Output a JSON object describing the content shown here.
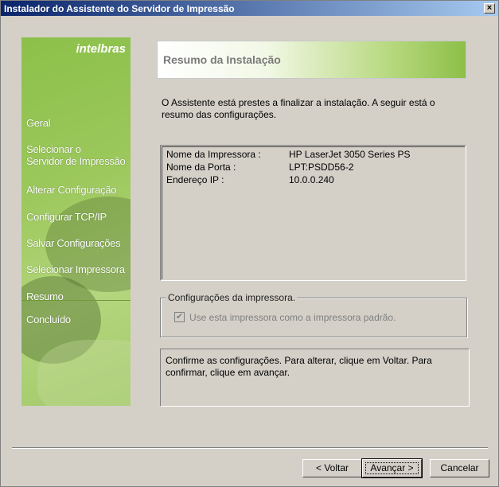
{
  "window": {
    "title": "Instalador do Assistente do Servidor de Impressão",
    "close_label": "×"
  },
  "sidebar": {
    "logo": "intelbras",
    "steps": [
      {
        "label": "Geral"
      },
      {
        "label": "Selecionar o\nServidor de Impressão"
      },
      {
        "label": "Alterar Configuração"
      },
      {
        "label": "Configurar TCP/IP"
      },
      {
        "label": "Salvar Configurações"
      },
      {
        "label": "Selecionar Impressora"
      },
      {
        "label": "Resumo"
      },
      {
        "label": "Concluído"
      }
    ],
    "current_step": "Resumo"
  },
  "header": {
    "title": "Resumo da Instalação"
  },
  "intro": "O Assistente está prestes a finalizar a instalação. A seguir está o resumo das configurações.",
  "summary": {
    "rows": [
      {
        "key": "Nome da Impressora :",
        "value": "HP LaserJet 3050 Series PS"
      },
      {
        "key": "Nome da Porta :",
        "value": "LPT:PSDD56-2"
      },
      {
        "key": "Endereço IP :",
        "value": "10.0.0.240"
      }
    ]
  },
  "printer_settings": {
    "legend": "Configurações da impressora.",
    "default_printer_label": "Use esta impressora como a impressora padrão.",
    "default_printer_checked": true,
    "default_printer_enabled": false
  },
  "note": "Confirme as configurações. Para alterar, clique em Voltar. Para confirmar, clique em avançar.",
  "buttons": {
    "back": "< Voltar",
    "next": "Avançar >",
    "cancel": "Cancelar"
  }
}
